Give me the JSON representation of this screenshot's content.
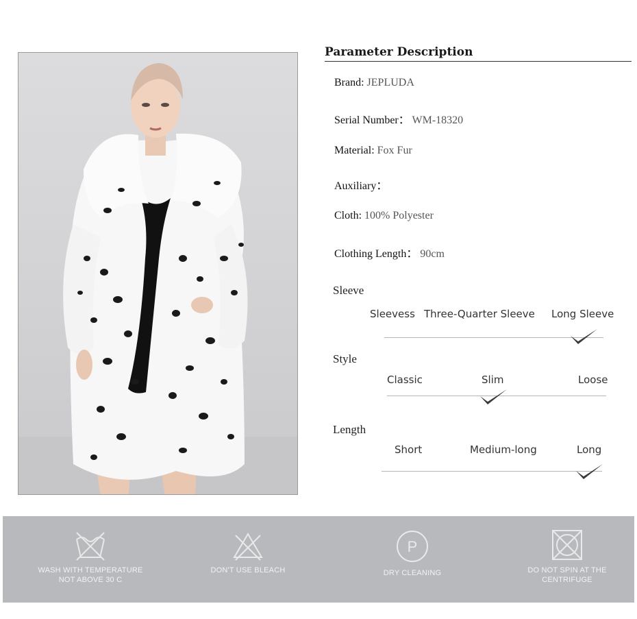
{
  "parameters": {
    "title": "Parameter Description",
    "brand_label": "Brand:",
    "brand_value": "JEPLUDA",
    "serial_label": "Serial Number：",
    "serial_value": "WM-18320",
    "material_label": "Material:",
    "material_value": "Fox Fur",
    "auxiliary_label": "Auxiliary：",
    "cloth_label": "Cloth:",
    "cloth_value": "100% Polyester",
    "length_label": "Clothing Length：",
    "length_value": "90cm"
  },
  "sleeve": {
    "title": "Sleeve",
    "options": [
      "Sleevess",
      "Three-Quarter Sleeve",
      "Long Sleeve"
    ],
    "selected": "Long Sleeve"
  },
  "style": {
    "title": "Style",
    "options": [
      "Classic",
      "Slim",
      "Loose"
    ],
    "selected": "Slim"
  },
  "length": {
    "title": "Length",
    "options": [
      "Short",
      "Medium-long",
      "Long"
    ],
    "selected": "Long"
  },
  "care": [
    {
      "icon": "wash-temperature-icon",
      "label": "WASH WITH TEMPERATURE\nNOT ABOVE 30 C"
    },
    {
      "icon": "no-bleach-icon",
      "label": "DON'T USE BLEACH"
    },
    {
      "icon": "dry-cleaning-icon",
      "label": "DRY CLEANING",
      "icon_letter": "P"
    },
    {
      "icon": "no-tumble-spin-icon",
      "label": "DO NOT SPIN AT THE\nCENTRIFUGE"
    }
  ],
  "colors": {
    "care_band": "#b8b9bc",
    "check": "#3a3a3a",
    "rule": "#333333"
  }
}
